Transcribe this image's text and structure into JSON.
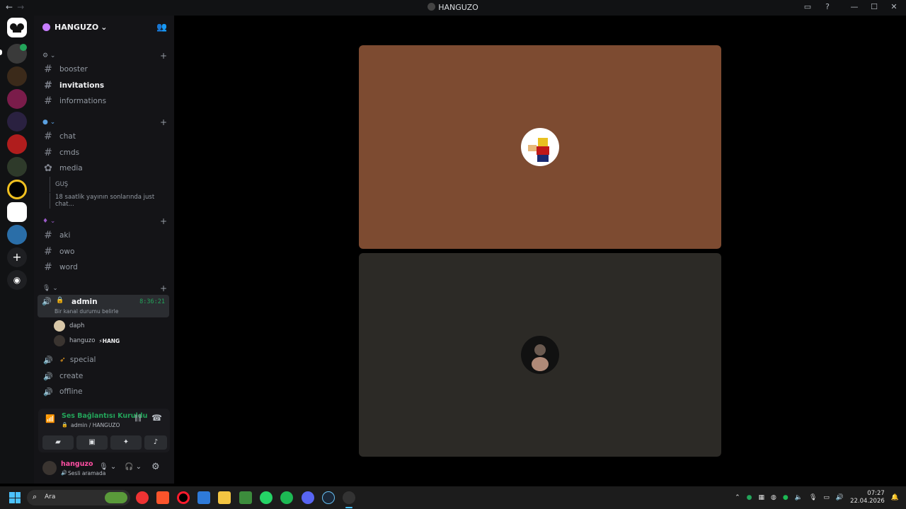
{
  "window": {
    "title": "HANGUZO",
    "nav_back": "←",
    "nav_fwd": "→",
    "min": "—",
    "max": "☐",
    "close": "✕"
  },
  "server": {
    "name": "HANGUZO",
    "chevron": "⌄"
  },
  "categories": [
    {
      "icon": "gear-icon"
    },
    {
      "icon": "globe-icon"
    },
    {
      "icon": "potion-icon"
    },
    {
      "icon": "mic-icon"
    }
  ],
  "channels": {
    "booster": "booster",
    "invitations": "invitations",
    "informations": "informations",
    "chat": "chat",
    "cmds": "cmds",
    "media": "media",
    "thread1": "GUŞ",
    "thread2": "18 saatlik yayının sonlarında just chat...",
    "aki": "aki",
    "owo": "owo",
    "word": "word",
    "admin": "admin",
    "admin_timer": "8:36:21",
    "admin_status": "Bir kanal durumu belirle",
    "special": "special",
    "create": "create",
    "offline": "offline"
  },
  "voice_users": [
    {
      "name": "daph",
      "tag": ""
    },
    {
      "name": "hanguzo",
      "tag": "⚡HANG"
    }
  ],
  "voice_panel": {
    "status": "Ses Bağlantısı Kuruldu",
    "location": "admin / HANGUZO"
  },
  "user": {
    "name": "hanguzo",
    "status": "Sesli aramada"
  },
  "taskbar": {
    "search": "Ara",
    "time": "07:27",
    "date": "22.04.2026"
  },
  "colors": {
    "accent_green": "#23a55a",
    "tile1": "#7d4b31",
    "tile2": "#2c2a26"
  }
}
